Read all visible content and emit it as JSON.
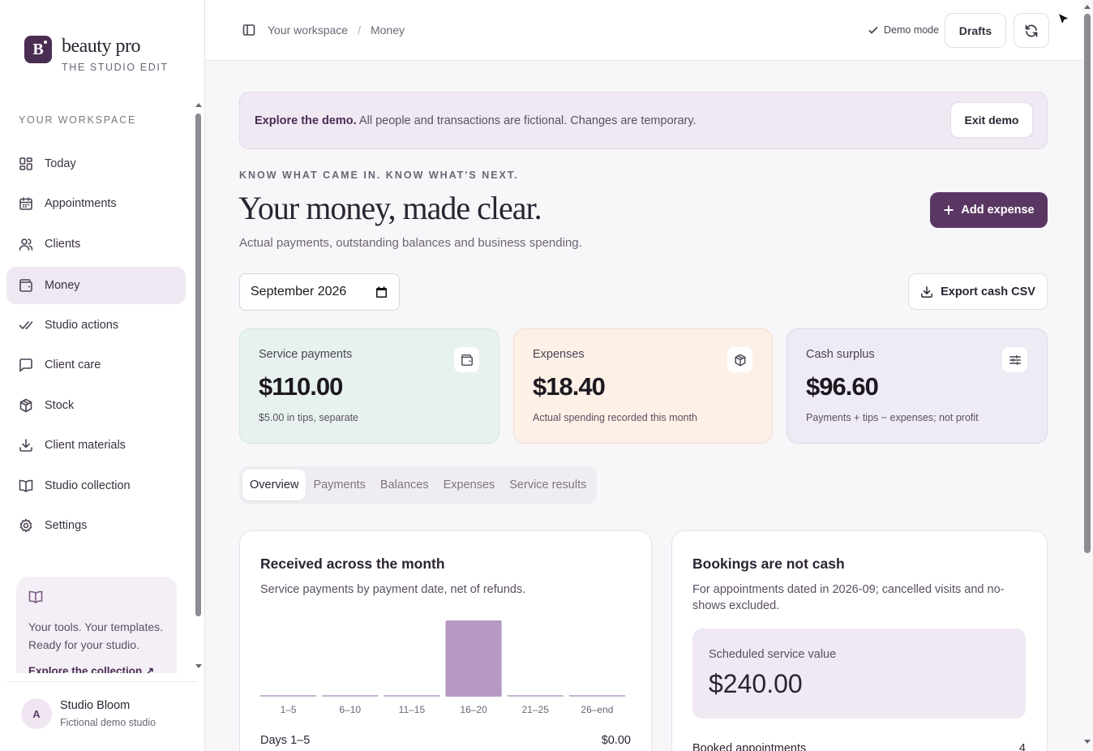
{
  "brand": {
    "name": "beauty pro",
    "tagline": "THE STUDIO EDIT",
    "logo_letter": "B"
  },
  "sidebar": {
    "section": "YOUR WORKSPACE",
    "items": [
      {
        "label": "Today",
        "icon": "dashboard-icon"
      },
      {
        "label": "Appointments",
        "icon": "calendar-icon"
      },
      {
        "label": "Clients",
        "icon": "users-icon"
      },
      {
        "label": "Money",
        "icon": "wallet-icon",
        "active": true
      },
      {
        "label": "Studio actions",
        "icon": "double-check-icon"
      },
      {
        "label": "Client care",
        "icon": "message-icon"
      },
      {
        "label": "Stock",
        "icon": "box-icon"
      },
      {
        "label": "Client materials",
        "icon": "download-icon"
      },
      {
        "label": "Studio collection",
        "icon": "book-icon"
      },
      {
        "label": "Settings",
        "icon": "gear-icon"
      }
    ],
    "promo": {
      "text": "Your tools. Your templates. Ready for your studio.",
      "link": "Explore the collection ↗"
    },
    "profile": {
      "initial": "A",
      "name": "Studio Bloom",
      "sub": "Fictional demo studio"
    }
  },
  "topbar": {
    "breadcrumb": [
      "Your workspace",
      "Money"
    ],
    "demo_mode": "Demo mode",
    "drafts": "Drafts"
  },
  "banner": {
    "bold": "Explore the demo.",
    "text": " All people and transactions are fictional. Changes are temporary.",
    "exit": "Exit demo"
  },
  "page": {
    "eyebrow": "KNOW WHAT CAME IN. KNOW WHAT'S NEXT.",
    "title": "Your money, made clear.",
    "subtitle": "Actual payments, outstanding balances and business spending.",
    "add_expense": "Add expense",
    "month_value": "September 2026",
    "export": "Export cash CSV"
  },
  "stats": [
    {
      "label": "Service payments",
      "value": "$110.00",
      "note": "$5.00 in tips, separate",
      "icon": "wallet-icon"
    },
    {
      "label": "Expenses",
      "value": "$18.40",
      "note": "Actual spending recorded this month",
      "icon": "box-icon"
    },
    {
      "label": "Cash surplus",
      "value": "$96.60",
      "note": "Payments + tips − expenses; not profit",
      "icon": "sliders-icon"
    }
  ],
  "tabs": [
    "Overview",
    "Payments",
    "Balances",
    "Expenses",
    "Service results"
  ],
  "received": {
    "title": "Received across the month",
    "desc": "Service payments by payment date, net of refunds.",
    "row_label": "Days 1–5",
    "row_value": "$0.00"
  },
  "chart_data": {
    "type": "bar",
    "categories": [
      "1–5",
      "6–10",
      "11–15",
      "16–20",
      "21–25",
      "26–end"
    ],
    "values": [
      0,
      0,
      0,
      110,
      0,
      0
    ],
    "colors": {
      "bar": "#b598c4",
      "baseline": "#c7b3d1"
    }
  },
  "bookings": {
    "title": "Bookings are not cash",
    "desc": "For appointments dated in 2026-09; cancelled visits and no-shows excluded.",
    "scheduled_label": "Scheduled service value",
    "scheduled_value": "$240.00",
    "booked_label": "Booked appointments",
    "booked_value": "4"
  }
}
